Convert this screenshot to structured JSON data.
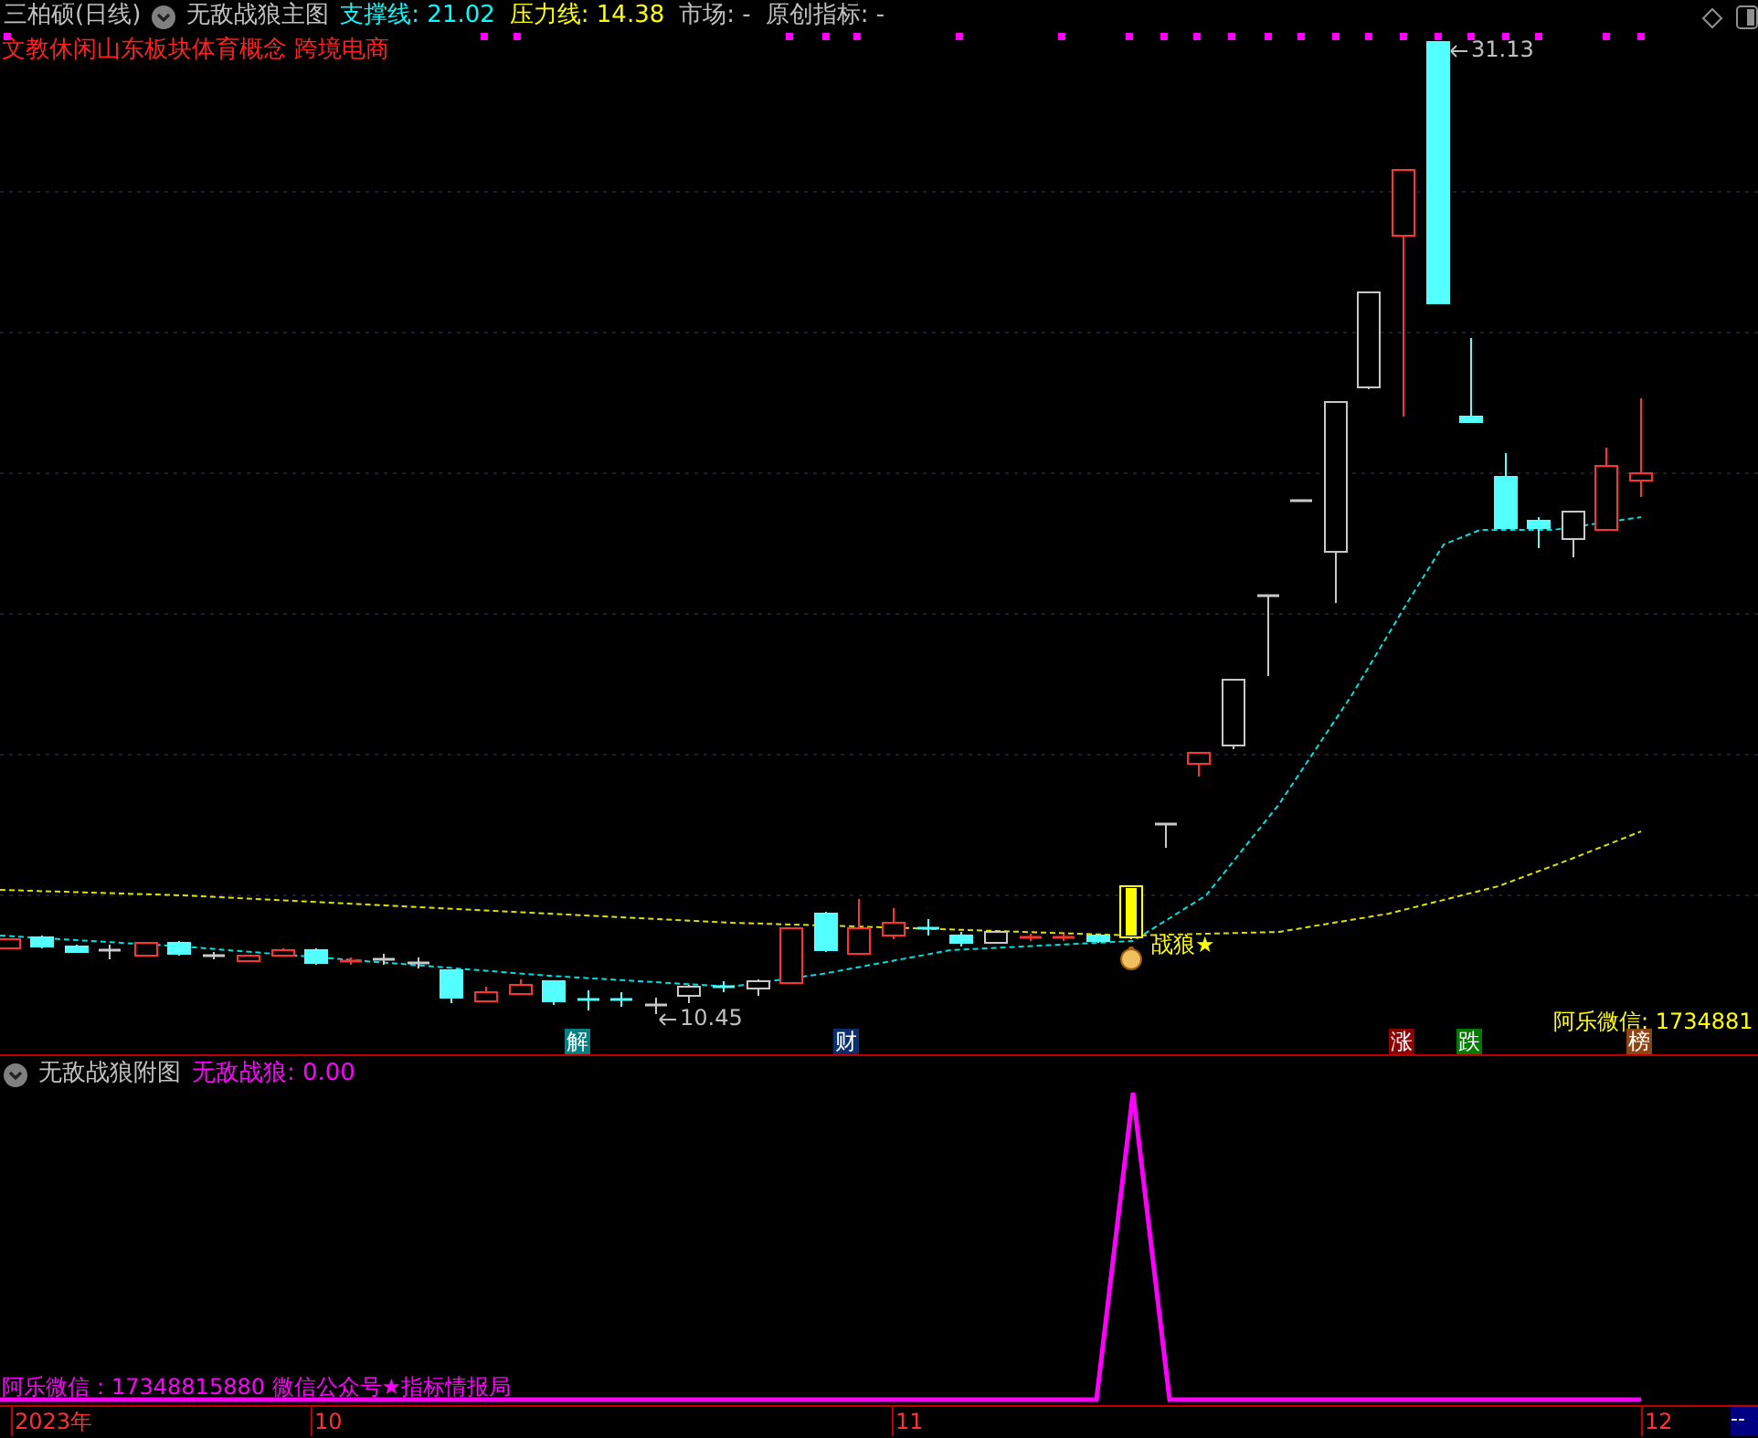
{
  "header": {
    "stock": "三柏硕(日线)",
    "indicator": "无敌战狼主图",
    "readouts": [
      {
        "text": "支撑线: 21.02",
        "color": "#00ffff"
      },
      {
        "text": "压力线: 14.38",
        "color": "#ffff00"
      },
      {
        "text": "市场: -",
        "color": "#c0c0c0"
      },
      {
        "text": "原创指标: -",
        "color": "#c0c0c0"
      }
    ]
  },
  "sectors": "文教休闲山东板块体育概念 跨境电商",
  "price_labels": [
    "31.13",
    "10.45"
  ],
  "signal_label": "战狼★",
  "contact_text": "阿乐微信: 1734881",
  "badges": [
    {
      "text": "解",
      "color": "#008080"
    },
    {
      "text": "财",
      "color": "#0a2f6e"
    },
    {
      "text": "涨",
      "color": "#8b0000"
    },
    {
      "text": "跌",
      "color": "#007a00"
    },
    {
      "text": "榜",
      "color": "#8b4513"
    }
  ],
  "sub_chart": {
    "title": "无敌战狼附图",
    "readout": "无敌战狼: 0.00",
    "footer": "阿乐微信：17348815880 微信公众号★指标情报局"
  },
  "axis": {
    "labels": [
      "2023年",
      "10",
      "11",
      "12"
    ],
    "corner": "--"
  }
}
